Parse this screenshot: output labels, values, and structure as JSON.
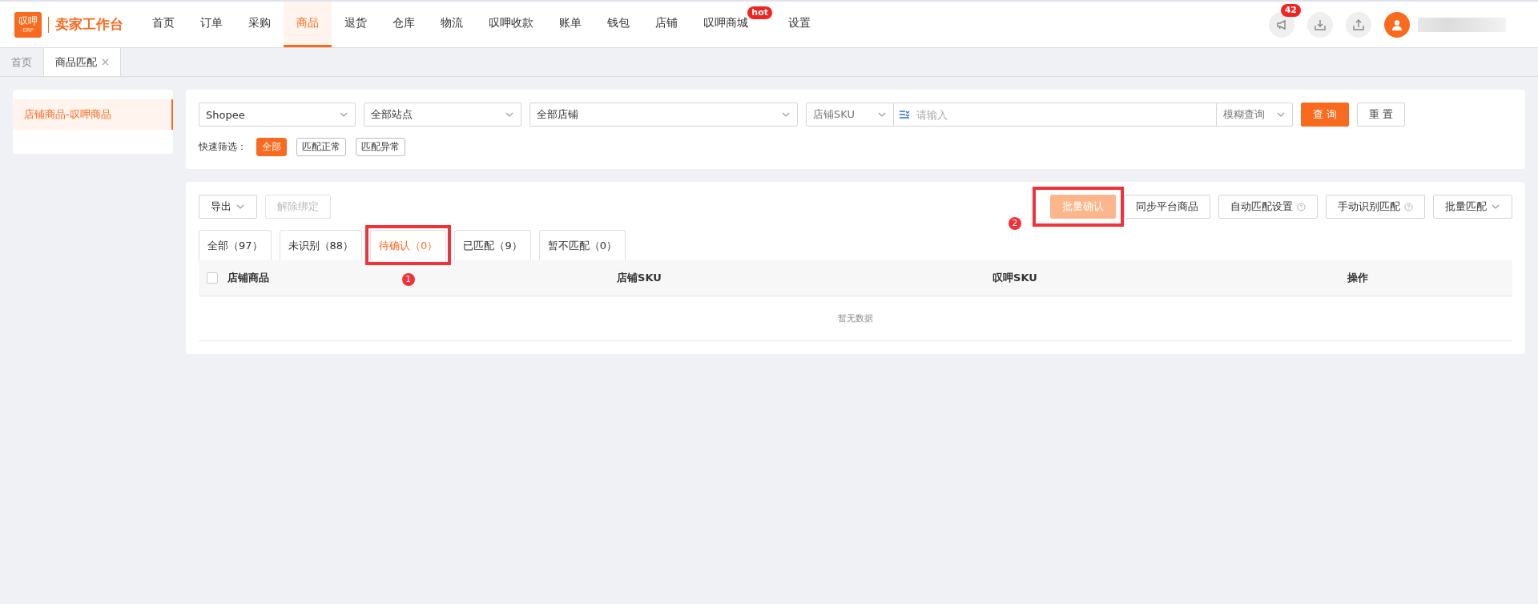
{
  "brand": {
    "logo_top": "叹呷",
    "logo_bottom": "ERP",
    "title": "卖家工作台"
  },
  "nav": [
    {
      "label": "首页",
      "selected": false
    },
    {
      "label": "订单",
      "selected": false
    },
    {
      "label": "采购",
      "selected": false
    },
    {
      "label": "商品",
      "selected": true
    },
    {
      "label": "退货",
      "selected": false
    },
    {
      "label": "仓库",
      "selected": false
    },
    {
      "label": "物流",
      "selected": false
    },
    {
      "label": "叹呷收款",
      "selected": false
    },
    {
      "label": "账单",
      "selected": false
    },
    {
      "label": "钱包",
      "selected": false
    },
    {
      "label": "店铺",
      "selected": false
    },
    {
      "label": "叹呷商城",
      "selected": false,
      "badge": "hot"
    },
    {
      "label": "设置",
      "selected": false
    }
  ],
  "header_actions": {
    "notification_count": "42"
  },
  "page_tabs": [
    {
      "label": "首页",
      "selected": false,
      "closable": false
    },
    {
      "label": "商品匹配",
      "selected": true,
      "closable": true
    }
  ],
  "sidebar": {
    "items": [
      {
        "label": "店铺商品-叹呷商品",
        "selected": true
      }
    ]
  },
  "filters": {
    "platform": "Shopee",
    "site": "全部站点",
    "shop": "全部店铺",
    "search_type": "店铺SKU",
    "search_placeholder": "请输入",
    "match_mode": "模糊查询",
    "query_button": "查 询",
    "reset_button": "重 置",
    "quick_label": "快速筛选：",
    "quick": [
      {
        "label": "全部",
        "selected": true
      },
      {
        "label": "匹配正常",
        "selected": false
      },
      {
        "label": "匹配异常",
        "selected": false
      }
    ]
  },
  "toolbar": {
    "left": [
      {
        "label": "导出",
        "kind": "dropdown",
        "disabled": false
      },
      {
        "label": "解除绑定",
        "kind": "plain",
        "disabled": true
      }
    ],
    "right": [
      {
        "label": "批量确认",
        "kind": "primary",
        "disabled": true,
        "callout": "2"
      },
      {
        "label": "同步平台商品",
        "kind": "plain",
        "disabled": false
      },
      {
        "label": "自动匹配设置",
        "kind": "help",
        "disabled": false
      },
      {
        "label": "手动识别匹配",
        "kind": "help",
        "disabled": false
      },
      {
        "label": "批量匹配",
        "kind": "dropdown",
        "disabled": false
      }
    ]
  },
  "tabs": [
    {
      "label": "全部（97）",
      "selected": false
    },
    {
      "label": "未识别（88）",
      "selected": false
    },
    {
      "label": "待确认（0）",
      "selected": true,
      "callout": "1"
    },
    {
      "label": "已匹配（9）",
      "selected": false
    },
    {
      "label": "暂不匹配（0）",
      "selected": false
    }
  ],
  "table": {
    "columns": [
      "店铺商品",
      "店铺SKU",
      "叹呷SKU",
      "操作"
    ],
    "select_all_checked": false,
    "empty_text": "暂无数据"
  }
}
